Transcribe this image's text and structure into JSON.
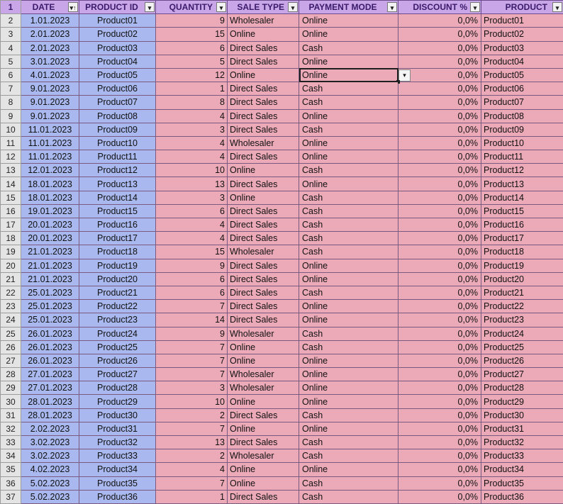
{
  "headers": {
    "row_no": "1",
    "date": "DATE",
    "product_id": "PRODUCT ID",
    "quantity": "QUANTITY",
    "sale_type": "SALE TYPE",
    "payment_mode": "PAYMENT MODE",
    "discount": "DISCOUNT %",
    "product": "PRODUCT"
  },
  "icons": {
    "filter": "filter-dropdown-icon",
    "sort_asc": "sort-ascending-filter-icon",
    "cell_dropdown": "data-validation-dropdown-icon"
  },
  "active_cell": {
    "row": 6,
    "column": "PAYMENT MODE"
  },
  "rows": [
    {
      "n": "2",
      "date": "1.01.2023",
      "pid": "Product01",
      "qty": "9",
      "st": "Wholesaler",
      "pm": "Online",
      "disc": "0,0%",
      "prod": "Product01"
    },
    {
      "n": "3",
      "date": "2.01.2023",
      "pid": "Product02",
      "qty": "15",
      "st": "Online",
      "pm": "Online",
      "disc": "0,0%",
      "prod": "Product02"
    },
    {
      "n": "4",
      "date": "2.01.2023",
      "pid": "Product03",
      "qty": "6",
      "st": "Direct Sales",
      "pm": "Cash",
      "disc": "0,0%",
      "prod": "Product03"
    },
    {
      "n": "5",
      "date": "3.01.2023",
      "pid": "Product04",
      "qty": "5",
      "st": "Direct Sales",
      "pm": "Online",
      "disc": "0,0%",
      "prod": "Product04"
    },
    {
      "n": "6",
      "date": "4.01.2023",
      "pid": "Product05",
      "qty": "12",
      "st": "Online",
      "pm": "Online",
      "disc": "0,0%",
      "prod": "Product05"
    },
    {
      "n": "7",
      "date": "9.01.2023",
      "pid": "Product06",
      "qty": "1",
      "st": "Direct Sales",
      "pm": "Cash",
      "disc": "0,0%",
      "prod": "Product06"
    },
    {
      "n": "8",
      "date": "9.01.2023",
      "pid": "Product07",
      "qty": "8",
      "st": "Direct Sales",
      "pm": "Cash",
      "disc": "0,0%",
      "prod": "Product07"
    },
    {
      "n": "9",
      "date": "9.01.2023",
      "pid": "Product08",
      "qty": "4",
      "st": "Direct Sales",
      "pm": "Online",
      "disc": "0,0%",
      "prod": "Product08"
    },
    {
      "n": "10",
      "date": "11.01.2023",
      "pid": "Product09",
      "qty": "3",
      "st": "Direct Sales",
      "pm": "Cash",
      "disc": "0,0%",
      "prod": "Product09"
    },
    {
      "n": "11",
      "date": "11.01.2023",
      "pid": "Product10",
      "qty": "4",
      "st": "Wholesaler",
      "pm": "Online",
      "disc": "0,0%",
      "prod": "Product10"
    },
    {
      "n": "12",
      "date": "11.01.2023",
      "pid": "Product11",
      "qty": "4",
      "st": "Direct Sales",
      "pm": "Online",
      "disc": "0,0%",
      "prod": "Product11"
    },
    {
      "n": "13",
      "date": "12.01.2023",
      "pid": "Product12",
      "qty": "10",
      "st": "Online",
      "pm": "Cash",
      "disc": "0,0%",
      "prod": "Product12"
    },
    {
      "n": "14",
      "date": "18.01.2023",
      "pid": "Product13",
      "qty": "13",
      "st": "Direct Sales",
      "pm": "Online",
      "disc": "0,0%",
      "prod": "Product13"
    },
    {
      "n": "15",
      "date": "18.01.2023",
      "pid": "Product14",
      "qty": "3",
      "st": "Online",
      "pm": "Cash",
      "disc": "0,0%",
      "prod": "Product14"
    },
    {
      "n": "16",
      "date": "19.01.2023",
      "pid": "Product15",
      "qty": "6",
      "st": "Direct Sales",
      "pm": "Cash",
      "disc": "0,0%",
      "prod": "Product15"
    },
    {
      "n": "17",
      "date": "20.01.2023",
      "pid": "Product16",
      "qty": "4",
      "st": "Direct Sales",
      "pm": "Cash",
      "disc": "0,0%",
      "prod": "Product16"
    },
    {
      "n": "18",
      "date": "20.01.2023",
      "pid": "Product17",
      "qty": "4",
      "st": "Direct Sales",
      "pm": "Cash",
      "disc": "0,0%",
      "prod": "Product17"
    },
    {
      "n": "19",
      "date": "21.01.2023",
      "pid": "Product18",
      "qty": "15",
      "st": "Wholesaler",
      "pm": "Cash",
      "disc": "0,0%",
      "prod": "Product18"
    },
    {
      "n": "20",
      "date": "21.01.2023",
      "pid": "Product19",
      "qty": "9",
      "st": "Direct Sales",
      "pm": "Online",
      "disc": "0,0%",
      "prod": "Product19"
    },
    {
      "n": "21",
      "date": "21.01.2023",
      "pid": "Product20",
      "qty": "6",
      "st": "Direct Sales",
      "pm": "Online",
      "disc": "0,0%",
      "prod": "Product20"
    },
    {
      "n": "22",
      "date": "25.01.2023",
      "pid": "Product21",
      "qty": "6",
      "st": "Direct Sales",
      "pm": "Cash",
      "disc": "0,0%",
      "prod": "Product21"
    },
    {
      "n": "23",
      "date": "25.01.2023",
      "pid": "Product22",
      "qty": "7",
      "st": "Direct Sales",
      "pm": "Online",
      "disc": "0,0%",
      "prod": "Product22"
    },
    {
      "n": "24",
      "date": "25.01.2023",
      "pid": "Product23",
      "qty": "14",
      "st": "Direct Sales",
      "pm": "Online",
      "disc": "0,0%",
      "prod": "Product23"
    },
    {
      "n": "25",
      "date": "26.01.2023",
      "pid": "Product24",
      "qty": "9",
      "st": "Wholesaler",
      "pm": "Cash",
      "disc": "0,0%",
      "prod": "Product24"
    },
    {
      "n": "26",
      "date": "26.01.2023",
      "pid": "Product25",
      "qty": "7",
      "st": "Online",
      "pm": "Cash",
      "disc": "0,0%",
      "prod": "Product25"
    },
    {
      "n": "27",
      "date": "26.01.2023",
      "pid": "Product26",
      "qty": "7",
      "st": "Online",
      "pm": "Online",
      "disc": "0,0%",
      "prod": "Product26"
    },
    {
      "n": "28",
      "date": "27.01.2023",
      "pid": "Product27",
      "qty": "7",
      "st": "Wholesaler",
      "pm": "Online",
      "disc": "0,0%",
      "prod": "Product27"
    },
    {
      "n": "29",
      "date": "27.01.2023",
      "pid": "Product28",
      "qty": "3",
      "st": "Wholesaler",
      "pm": "Online",
      "disc": "0,0%",
      "prod": "Product28"
    },
    {
      "n": "30",
      "date": "28.01.2023",
      "pid": "Product29",
      "qty": "10",
      "st": "Online",
      "pm": "Online",
      "disc": "0,0%",
      "prod": "Product29"
    },
    {
      "n": "31",
      "date": "28.01.2023",
      "pid": "Product30",
      "qty": "2",
      "st": "Direct Sales",
      "pm": "Cash",
      "disc": "0,0%",
      "prod": "Product30"
    },
    {
      "n": "32",
      "date": "2.02.2023",
      "pid": "Product31",
      "qty": "7",
      "st": "Online",
      "pm": "Online",
      "disc": "0,0%",
      "prod": "Product31"
    },
    {
      "n": "33",
      "date": "3.02.2023",
      "pid": "Product32",
      "qty": "13",
      "st": "Direct Sales",
      "pm": "Cash",
      "disc": "0,0%",
      "prod": "Product32"
    },
    {
      "n": "34",
      "date": "3.02.2023",
      "pid": "Product33",
      "qty": "2",
      "st": "Wholesaler",
      "pm": "Cash",
      "disc": "0,0%",
      "prod": "Product33"
    },
    {
      "n": "35",
      "date": "4.02.2023",
      "pid": "Product34",
      "qty": "4",
      "st": "Online",
      "pm": "Online",
      "disc": "0,0%",
      "prod": "Product34"
    },
    {
      "n": "36",
      "date": "5.02.2023",
      "pid": "Product35",
      "qty": "7",
      "st": "Online",
      "pm": "Cash",
      "disc": "0,0%",
      "prod": "Product35"
    },
    {
      "n": "37",
      "date": "5.02.2023",
      "pid": "Product36",
      "qty": "1",
      "st": "Direct Sales",
      "pm": "Cash",
      "disc": "0,0%",
      "prod": "Product36"
    }
  ]
}
